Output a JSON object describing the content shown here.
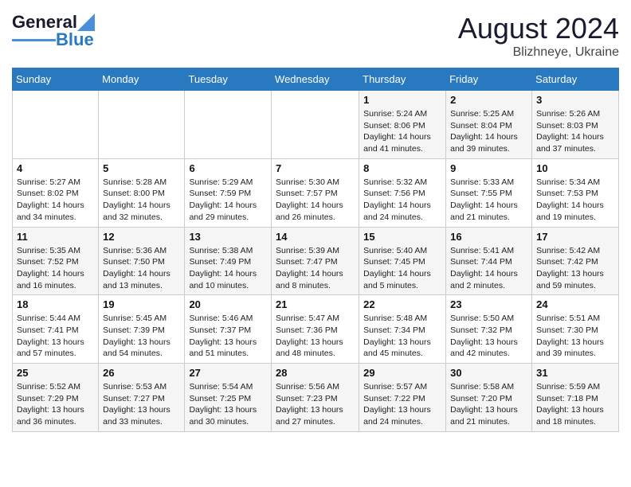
{
  "header": {
    "logo_general": "General",
    "logo_blue": "Blue",
    "month_year": "August 2024",
    "location": "Blizhneye, Ukraine"
  },
  "weekdays": [
    "Sunday",
    "Monday",
    "Tuesday",
    "Wednesday",
    "Thursday",
    "Friday",
    "Saturday"
  ],
  "weeks": [
    [
      {
        "day": "",
        "info": ""
      },
      {
        "day": "",
        "info": ""
      },
      {
        "day": "",
        "info": ""
      },
      {
        "day": "",
        "info": ""
      },
      {
        "day": "1",
        "info": "Sunrise: 5:24 AM\nSunset: 8:06 PM\nDaylight: 14 hours\nand 41 minutes."
      },
      {
        "day": "2",
        "info": "Sunrise: 5:25 AM\nSunset: 8:04 PM\nDaylight: 14 hours\nand 39 minutes."
      },
      {
        "day": "3",
        "info": "Sunrise: 5:26 AM\nSunset: 8:03 PM\nDaylight: 14 hours\nand 37 minutes."
      }
    ],
    [
      {
        "day": "4",
        "info": "Sunrise: 5:27 AM\nSunset: 8:02 PM\nDaylight: 14 hours\nand 34 minutes."
      },
      {
        "day": "5",
        "info": "Sunrise: 5:28 AM\nSunset: 8:00 PM\nDaylight: 14 hours\nand 32 minutes."
      },
      {
        "day": "6",
        "info": "Sunrise: 5:29 AM\nSunset: 7:59 PM\nDaylight: 14 hours\nand 29 minutes."
      },
      {
        "day": "7",
        "info": "Sunrise: 5:30 AM\nSunset: 7:57 PM\nDaylight: 14 hours\nand 26 minutes."
      },
      {
        "day": "8",
        "info": "Sunrise: 5:32 AM\nSunset: 7:56 PM\nDaylight: 14 hours\nand 24 minutes."
      },
      {
        "day": "9",
        "info": "Sunrise: 5:33 AM\nSunset: 7:55 PM\nDaylight: 14 hours\nand 21 minutes."
      },
      {
        "day": "10",
        "info": "Sunrise: 5:34 AM\nSunset: 7:53 PM\nDaylight: 14 hours\nand 19 minutes."
      }
    ],
    [
      {
        "day": "11",
        "info": "Sunrise: 5:35 AM\nSunset: 7:52 PM\nDaylight: 14 hours\nand 16 minutes."
      },
      {
        "day": "12",
        "info": "Sunrise: 5:36 AM\nSunset: 7:50 PM\nDaylight: 14 hours\nand 13 minutes."
      },
      {
        "day": "13",
        "info": "Sunrise: 5:38 AM\nSunset: 7:49 PM\nDaylight: 14 hours\nand 10 minutes."
      },
      {
        "day": "14",
        "info": "Sunrise: 5:39 AM\nSunset: 7:47 PM\nDaylight: 14 hours\nand 8 minutes."
      },
      {
        "day": "15",
        "info": "Sunrise: 5:40 AM\nSunset: 7:45 PM\nDaylight: 14 hours\nand 5 minutes."
      },
      {
        "day": "16",
        "info": "Sunrise: 5:41 AM\nSunset: 7:44 PM\nDaylight: 14 hours\nand 2 minutes."
      },
      {
        "day": "17",
        "info": "Sunrise: 5:42 AM\nSunset: 7:42 PM\nDaylight: 13 hours\nand 59 minutes."
      }
    ],
    [
      {
        "day": "18",
        "info": "Sunrise: 5:44 AM\nSunset: 7:41 PM\nDaylight: 13 hours\nand 57 minutes."
      },
      {
        "day": "19",
        "info": "Sunrise: 5:45 AM\nSunset: 7:39 PM\nDaylight: 13 hours\nand 54 minutes."
      },
      {
        "day": "20",
        "info": "Sunrise: 5:46 AM\nSunset: 7:37 PM\nDaylight: 13 hours\nand 51 minutes."
      },
      {
        "day": "21",
        "info": "Sunrise: 5:47 AM\nSunset: 7:36 PM\nDaylight: 13 hours\nand 48 minutes."
      },
      {
        "day": "22",
        "info": "Sunrise: 5:48 AM\nSunset: 7:34 PM\nDaylight: 13 hours\nand 45 minutes."
      },
      {
        "day": "23",
        "info": "Sunrise: 5:50 AM\nSunset: 7:32 PM\nDaylight: 13 hours\nand 42 minutes."
      },
      {
        "day": "24",
        "info": "Sunrise: 5:51 AM\nSunset: 7:30 PM\nDaylight: 13 hours\nand 39 minutes."
      }
    ],
    [
      {
        "day": "25",
        "info": "Sunrise: 5:52 AM\nSunset: 7:29 PM\nDaylight: 13 hours\nand 36 minutes."
      },
      {
        "day": "26",
        "info": "Sunrise: 5:53 AM\nSunset: 7:27 PM\nDaylight: 13 hours\nand 33 minutes."
      },
      {
        "day": "27",
        "info": "Sunrise: 5:54 AM\nSunset: 7:25 PM\nDaylight: 13 hours\nand 30 minutes."
      },
      {
        "day": "28",
        "info": "Sunrise: 5:56 AM\nSunset: 7:23 PM\nDaylight: 13 hours\nand 27 minutes."
      },
      {
        "day": "29",
        "info": "Sunrise: 5:57 AM\nSunset: 7:22 PM\nDaylight: 13 hours\nand 24 minutes."
      },
      {
        "day": "30",
        "info": "Sunrise: 5:58 AM\nSunset: 7:20 PM\nDaylight: 13 hours\nand 21 minutes."
      },
      {
        "day": "31",
        "info": "Sunrise: 5:59 AM\nSunset: 7:18 PM\nDaylight: 13 hours\nand 18 minutes."
      }
    ]
  ]
}
